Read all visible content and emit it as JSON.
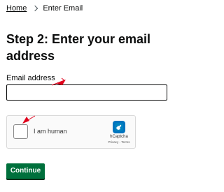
{
  "breadcrumb": {
    "home_label": "Home",
    "current_label": "Enter Email"
  },
  "main": {
    "title": "Step 2: Enter your email address",
    "email_field": {
      "label": "Email address",
      "value": "",
      "placeholder": ""
    },
    "captcha": {
      "checkbox_label": "I am human",
      "brand": "hCaptcha",
      "privacy_link": "Privacy",
      "terms_link": "Terms",
      "link_separator": " - ",
      "logo_icon": "hcaptcha-logo-icon"
    },
    "continue_label": "Continue"
  },
  "colors": {
    "primary_button": "#00703c",
    "annotation_arrow": "#e0001b"
  }
}
